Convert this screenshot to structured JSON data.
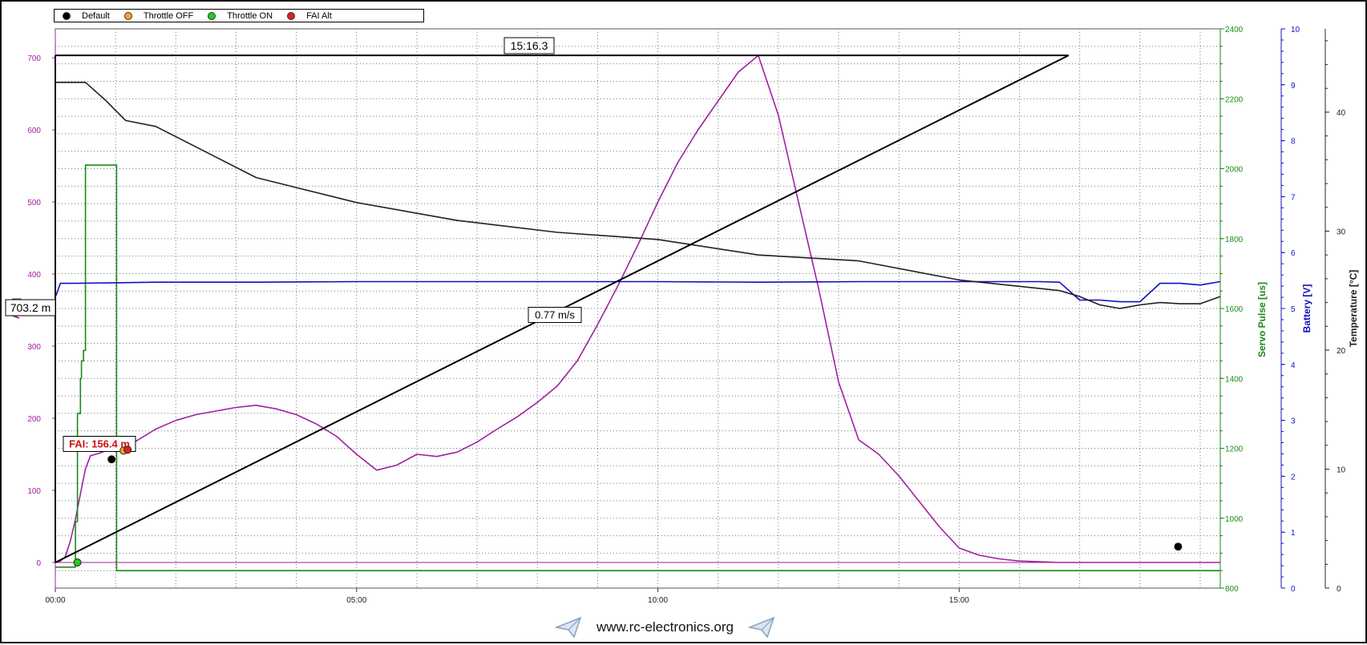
{
  "legend": [
    {
      "label": "Default",
      "color": "#000000"
    },
    {
      "label": "Throttle OFF",
      "color": "#f5a623"
    },
    {
      "label": "Throttle ON",
      "color": "#22cc22"
    },
    {
      "label": "FAI Alt",
      "color": "#e02020"
    }
  ],
  "footer": {
    "url": "www.rc-electronics.org",
    "icon": "paper-plane-icon"
  },
  "colors": {
    "altitude": "#a020a0",
    "servo": "#1a8a1a",
    "battery": "#1010c0",
    "temperature": "#202020"
  },
  "chart_data": {
    "type": "line",
    "x_unit": "mm:ss",
    "x_ticks": [
      "00:00",
      "05:00",
      "10:00",
      "15:00"
    ],
    "xlim_seconds": [
      0,
      1160
    ],
    "axes": {
      "altitude": {
        "label_visible": "A m]",
        "ylim": [
          0,
          700
        ],
        "ticks": [
          "0",
          "100",
          "200",
          "300",
          "400",
          "500",
          "600",
          "700"
        ]
      },
      "servo": {
        "label": "Servo Pulse [us]",
        "ylim": [
          800,
          2400
        ],
        "ticks": [
          "800",
          "1000",
          "1200",
          "1400",
          "1600",
          "1800",
          "2000",
          "2200",
          "2400"
        ]
      },
      "battery": {
        "label": "Battery [V]",
        "ylim": [
          0,
          10
        ],
        "ticks": [
          "0",
          "1",
          "2",
          "3",
          "4",
          "5",
          "6",
          "7",
          "8",
          "9",
          "10"
        ]
      },
      "temperature": {
        "label": "Temperature [°C]",
        "ylim": [
          0,
          47
        ],
        "ticks": [
          "0",
          "10",
          "20",
          "30",
          "40"
        ]
      }
    },
    "series": [
      {
        "key": "altitude",
        "axis": "altitude",
        "x": [
          0,
          5,
          10,
          15,
          20,
          25,
          30,
          35,
          40,
          45,
          50,
          60,
          80,
          100,
          120,
          140,
          160,
          180,
          200,
          220,
          240,
          260,
          280,
          300,
          320,
          340,
          360,
          380,
          400,
          420,
          440,
          460,
          480,
          500,
          520,
          540,
          560,
          580,
          600,
          620,
          640,
          660,
          680,
          700,
          720,
          740,
          760,
          780,
          800,
          820,
          840,
          860,
          880,
          900,
          920,
          940,
          960,
          980,
          1000,
          1020,
          1040,
          1060,
          1080,
          1090,
          1100,
          1110,
          1120,
          1130,
          1140,
          1150,
          1160
        ],
        "y": [
          0,
          2,
          8,
          30,
          60,
          95,
          130,
          148,
          150,
          152,
          155,
          158,
          168,
          185,
          197,
          205,
          210,
          215,
          218,
          213,
          205,
          192,
          175,
          150,
          128,
          135,
          150,
          147,
          153,
          167,
          185,
          202,
          222,
          245,
          280,
          330,
          383,
          440,
          500,
          555,
          600,
          640,
          680,
          703,
          620,
          500,
          380,
          250,
          170,
          150,
          120,
          85,
          50,
          20,
          10,
          5,
          2,
          1,
          0,
          0,
          0,
          0,
          0,
          0,
          0,
          0,
          0,
          0,
          0,
          0,
          0
        ]
      },
      {
        "key": "servo",
        "axis": "servo",
        "x": [
          0,
          5,
          15,
          20,
          22,
          25,
          26,
          28,
          30,
          55,
          60,
          61,
          1160
        ],
        "y": [
          860,
          860,
          860,
          990,
          1300,
          1400,
          1450,
          1480,
          2010,
          2010,
          2010,
          850,
          850
        ]
      },
      {
        "key": "battery",
        "axis": "battery",
        "x": [
          0,
          5,
          20,
          100,
          200,
          300,
          400,
          500,
          600,
          700,
          800,
          900,
          980,
          1000,
          1020,
          1040,
          1060,
          1080,
          1100,
          1120,
          1140,
          1160
        ],
        "y": [
          5.2,
          5.45,
          5.45,
          5.47,
          5.47,
          5.48,
          5.48,
          5.48,
          5.48,
          5.47,
          5.48,
          5.48,
          5.48,
          5.47,
          5.15,
          5.15,
          5.12,
          5.12,
          5.45,
          5.45,
          5.42,
          5.48
        ]
      },
      {
        "key": "temperature",
        "axis": "temperature",
        "x": [
          0,
          30,
          50,
          70,
          100,
          200,
          300,
          400,
          500,
          600,
          700,
          800,
          900,
          1000,
          1020,
          1040,
          1060,
          1080,
          1100,
          1120,
          1140,
          1160
        ],
        "y": [
          42.5,
          42.5,
          41,
          39.3,
          38.8,
          34.5,
          32.4,
          30.9,
          29.9,
          29.3,
          28.0,
          27.5,
          25.9,
          25.0,
          24.5,
          23.8,
          23.5,
          23.8,
          24.0,
          23.9,
          23.9,
          24.5
        ]
      }
    ],
    "markers": [
      {
        "kind": "Default",
        "x": 56,
        "y_alt": 143
      },
      {
        "kind": "Throttle OFF",
        "x": 68,
        "y_alt": 155
      },
      {
        "kind": "Throttle ON",
        "x": 22,
        "y_alt": 0
      },
      {
        "kind": "FAI Alt",
        "x": 72,
        "y_alt": 156.4
      },
      {
        "kind": "Default",
        "x": 1118,
        "y_alt": 22
      }
    ],
    "annotations": {
      "duration": "15:16.3",
      "max_alt": "703.2 m",
      "climb_rate": "0.77 m/s",
      "fai_label": "FAI: 156.4 m",
      "ref_line_alt": 703.2,
      "ref_line_end_x": 1009
    },
    "grid": true
  }
}
